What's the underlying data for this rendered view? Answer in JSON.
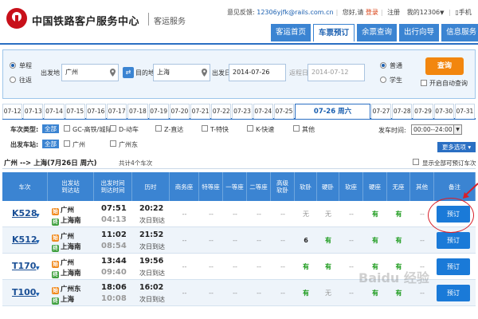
{
  "header": {
    "brand": "中国铁路客户服务中心",
    "sub": "客运服务",
    "feedback_label": "意见反馈:",
    "feedback_mail": "12306yjfk@rails.com.cn",
    "greeting": "您好,请",
    "login": "登录",
    "register": "注册",
    "my12306": "我的12306",
    "mobile": "手机"
  },
  "nav": {
    "items": [
      "客运首页",
      "车票预订",
      "余票查询",
      "出行向导",
      "信息服务"
    ],
    "active": "车票预订"
  },
  "search": {
    "trip_oneway": "单程",
    "trip_round": "往返",
    "from_label": "出发地",
    "from_value": "广州",
    "to_label": "目的地",
    "to_value": "上海",
    "date_label": "出发日",
    "date_value": "2014-07-26",
    "return_label": "返程日",
    "return_value": "2014-07-12",
    "type_normal": "普通",
    "type_student": "学生",
    "query_btn": "查询",
    "auto_query": "开启自动查询"
  },
  "dates": {
    "tabs": [
      "07-12",
      "07-13",
      "07-14",
      "07-15",
      "07-16",
      "07-17",
      "07-18",
      "07-19",
      "07-20",
      "07-21",
      "07-22",
      "07-23",
      "07-24",
      "07-25",
      "07-26 周六",
      "07-27",
      "07-28",
      "07-29",
      "07-30",
      "07-31"
    ],
    "active": "07-26 周六"
  },
  "filters": {
    "type_label": "车次类型:",
    "all": "全部",
    "types": [
      "GC-高铁/城际",
      "D-动车",
      "Z-直达",
      "T-特快",
      "K-快速",
      "其他"
    ],
    "station_label": "出发车站:",
    "stations": [
      "广州",
      "广州东"
    ],
    "depart_time_label": "发车时间:",
    "depart_time_value": "00:00--24:00",
    "more": "更多选项"
  },
  "summary": {
    "route": "广州 --> 上海(7月26日 周六)",
    "count": "共计4个车次",
    "show_all": "显示全部可预订车次"
  },
  "table": {
    "headers": [
      "车次",
      "出发站\n到达站",
      "出发时间\n到达时间",
      "历时",
      "商务座",
      "特等座",
      "一等座",
      "二等座",
      "高级\n软卧",
      "软卧",
      "硬卧",
      "软座",
      "硬座",
      "无座",
      "其他",
      "备注"
    ],
    "rows": [
      {
        "train": "K528",
        "from": "广州",
        "to": "上海南",
        "dep": "07:51",
        "arr": "04:13",
        "dur": "20:22",
        "arrive_day": "次日到达",
        "seats": [
          "--",
          "--",
          "--",
          "--",
          "--",
          "无",
          "无",
          "--",
          "有",
          "有",
          "--"
        ],
        "book": "预订"
      },
      {
        "train": "K512",
        "from": "广州",
        "to": "上海南",
        "dep": "11:02",
        "arr": "08:54",
        "dur": "21:52",
        "arrive_day": "次日到达",
        "seats": [
          "--",
          "--",
          "--",
          "--",
          "--",
          "6",
          "有",
          "--",
          "有",
          "有",
          "--"
        ],
        "book": "预订"
      },
      {
        "train": "T170",
        "from": "广州",
        "to": "上海南",
        "dep": "13:44",
        "arr": "09:40",
        "dur": "19:56",
        "arrive_day": "次日到达",
        "seats": [
          "--",
          "--",
          "--",
          "--",
          "--",
          "有",
          "有",
          "--",
          "有",
          "有",
          "--"
        ],
        "book": "预订"
      },
      {
        "train": "T100",
        "from": "广州东",
        "to": "上海",
        "dep": "18:06",
        "arr": "10:08",
        "dur": "16:02",
        "arrive_day": "次日到达",
        "seats": [
          "--",
          "--",
          "--",
          "--",
          "--",
          "有",
          "无",
          "--",
          "有",
          "有",
          "--"
        ],
        "book": "预订"
      }
    ]
  },
  "watermark": "Baidu 经验",
  "colors": {
    "primary": "#3b84d2",
    "accent": "#f2860e",
    "available": "#1a9a1a",
    "highlight": "#d8202a"
  }
}
